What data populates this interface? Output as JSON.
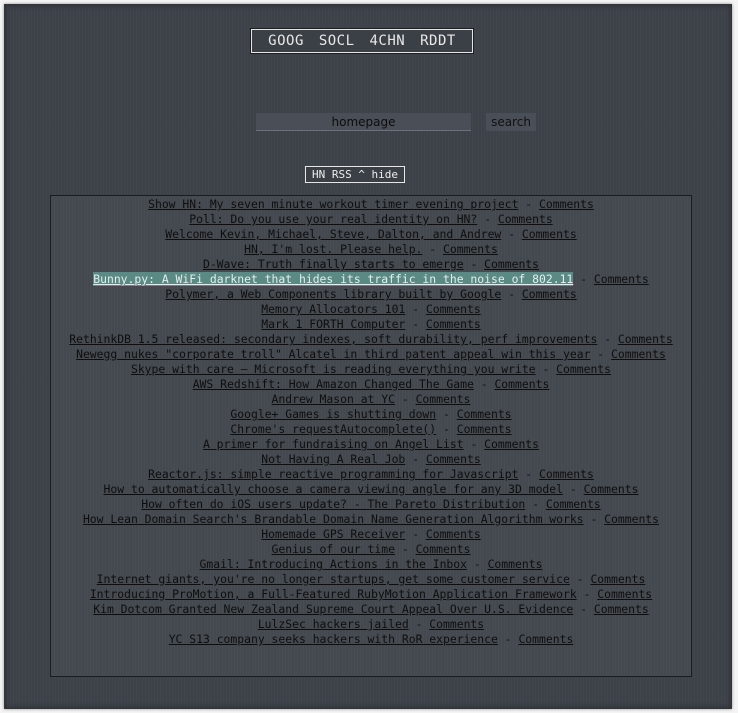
{
  "nav": {
    "items": [
      "GOOG",
      "SOCL",
      "4CHN",
      "RDDT"
    ]
  },
  "search": {
    "value": "homepage",
    "button_label": "search"
  },
  "feed_toggle": {
    "label": "HN RSS ^ hide"
  },
  "feed": {
    "separator": "-",
    "comments_label": "Comments",
    "highlighted_index": 5,
    "items": [
      "Show HN: My seven minute workout timer evening project",
      "Poll: Do you use your real identity on HN?",
      "Welcome Kevin, Michael, Steve, Dalton, and Andrew",
      "HN, I'm lost. Please help.",
      "D-Wave: Truth finally starts to emerge",
      "Bunny.py: A WiFi darknet that hides its traffic in the noise of 802.11",
      "Polymer, a Web Components library built by Google",
      "Memory Allocators 101",
      "Mark 1 FORTH Computer",
      "RethinkDB 1.5 released: secondary indexes, soft durability, perf improvements",
      "Newegg nukes \"corporate troll\" Alcatel in third patent appeal win this year",
      "Skype with care – Microsoft is reading everything you write",
      "AWS Redshift: How Amazon Changed The Game",
      "Andrew Mason at YC",
      "Google+ Games is shutting down",
      "Chrome's requestAutocomplete()",
      "A primer for fundraising on Angel List",
      "Not Having A Real Job",
      "Reactor.js: simple reactive programming for Javascript",
      "How to automatically choose a camera viewing angle for any 3D model",
      "How often do iOS users update? - The Pareto Distribution",
      "How Lean Domain Search's Brandable Domain Name Generation Algorithm works",
      "Homemade GPS Receiver",
      "Genius of our time",
      "Gmail: Introducing Actions in the Inbox",
      "Internet giants, you're no longer startups, get some customer service",
      "Introducing ProMotion, a Full-Featured RubyMotion Application Framework",
      "Kim Dotcom Granted New Zealand Supreme Court Appeal Over U.S. Evidence",
      "LulzSec hackers jailed",
      "YC S13 company seeks hackers with RoR experience"
    ]
  }
}
